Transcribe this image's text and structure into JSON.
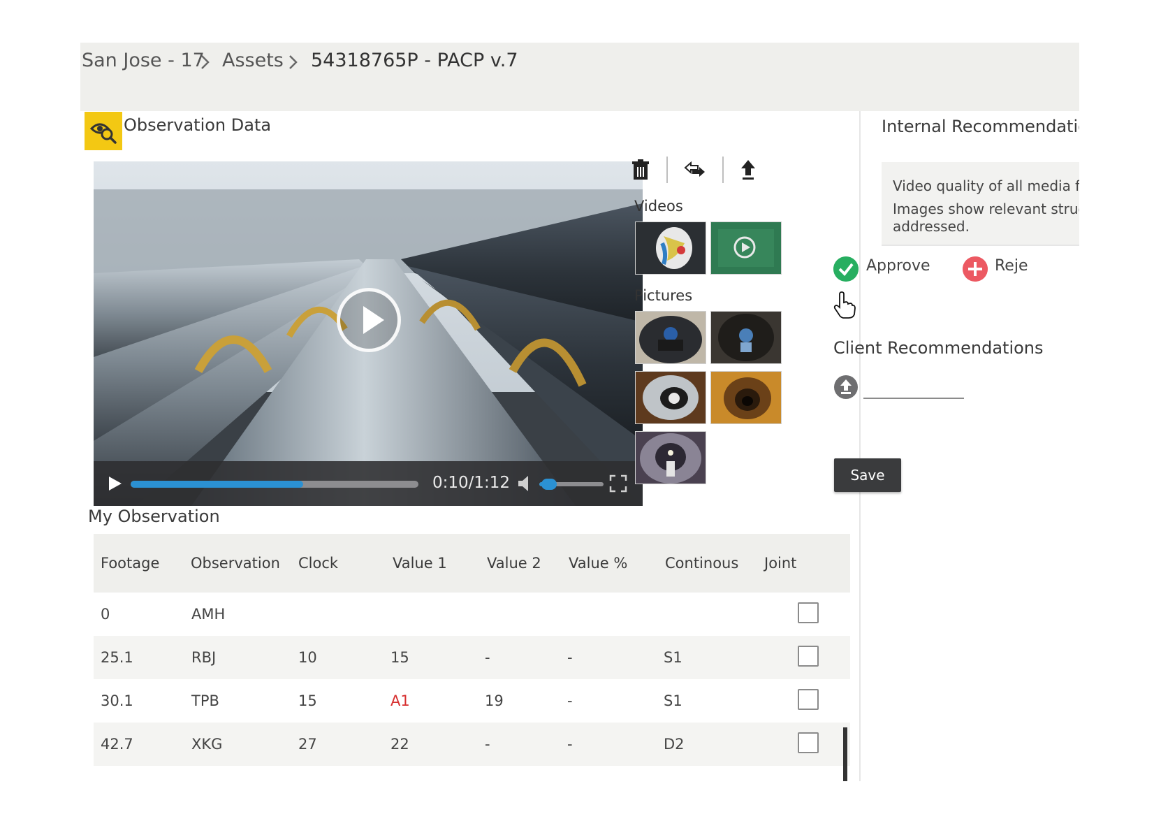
{
  "breadcrumb": {
    "items": [
      "San Jose - 17",
      "Assets",
      "54318765P - PACP v.7"
    ]
  },
  "observation": {
    "title": "Observation Data",
    "player": {
      "time": "0:10/1:12",
      "progress": 0.6,
      "volume": 0.25
    },
    "toolbar": {
      "icons": [
        "trash-icon",
        "transfer-icon",
        "upload-icon"
      ]
    },
    "media": {
      "videos_label": "Videos",
      "pictures_label": "Pictures"
    }
  },
  "my_observation": {
    "title": "My Observation",
    "columns": [
      "Footage",
      "Observation",
      "Clock",
      "Value 1",
      "Value 2",
      "Value %",
      "Continous",
      "Joint"
    ],
    "rows": [
      {
        "footage": "0",
        "observation": "AMH",
        "clock": "",
        "value1": "",
        "value2": "",
        "value_pct": "",
        "continous": ""
      },
      {
        "footage": "25.1",
        "observation": "RBJ",
        "clock": "10",
        "value1": "15",
        "value2": "-",
        "value_pct": "-",
        "continous": "S1"
      },
      {
        "footage": "30.1",
        "observation": "TPB",
        "clock": "15",
        "value1": "A1",
        "value2": "19",
        "value_pct": "-",
        "continous": "S1"
      },
      {
        "footage": "42.7",
        "observation": "XKG",
        "clock": "27",
        "value1": "22",
        "value2": "-",
        "value_pct": "-",
        "continous": "D2"
      }
    ]
  },
  "internal_recommendation": {
    "title": "Internal Recommendatio",
    "text_lines": [
      "Video quality of all media files",
      "Images show relevant structu",
      "addressed."
    ],
    "approve_label": "Approve",
    "reject_label": "Reje"
  },
  "client_recommendations": {
    "title": "Client Recommendations",
    "save_label": "Save"
  },
  "colors": {
    "accent_yellow": "#f3c813",
    "progress_blue": "#2b91d3",
    "approve_green": "#27ae60",
    "reject_red": "#ec5962",
    "value_red": "#d73030"
  }
}
